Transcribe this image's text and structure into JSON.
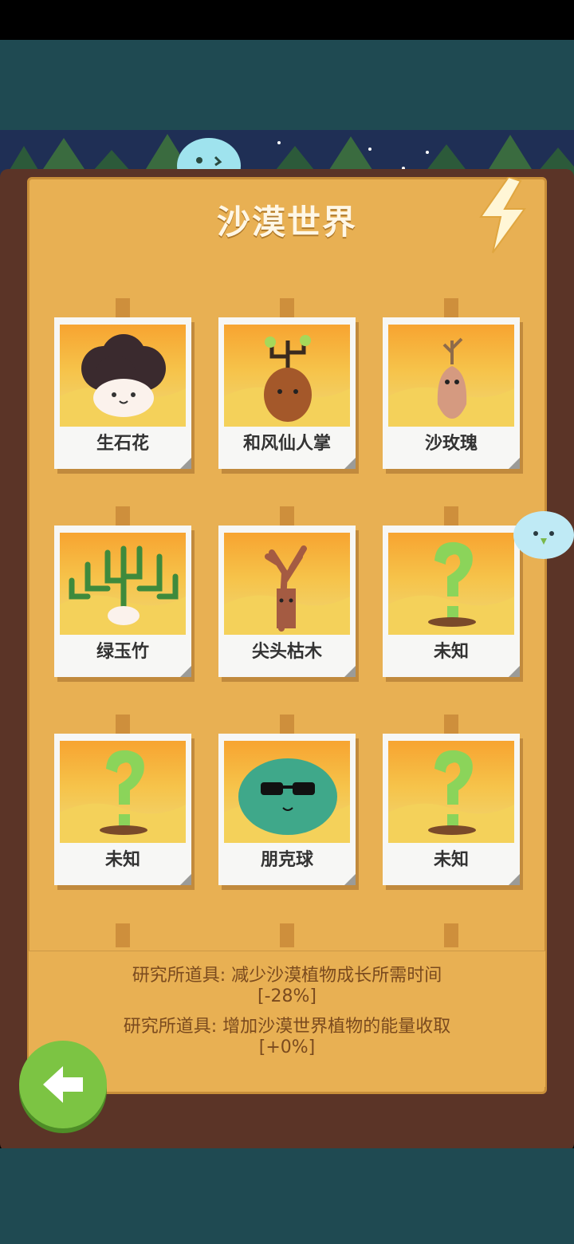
{
  "header": {
    "title": "沙漠世界"
  },
  "plants": [
    {
      "name": "生石花",
      "art": "lithops-icon"
    },
    {
      "name": "和风仙人掌",
      "art": "cactus-icon"
    },
    {
      "name": "沙玫瑰",
      "art": "desert-rose-icon"
    },
    {
      "name": "绿玉竹",
      "art": "pencil-cactus-icon"
    },
    {
      "name": "尖头枯木",
      "art": "dead-tree-icon"
    },
    {
      "name": "未知",
      "art": "question-mark-icon"
    },
    {
      "name": "未知",
      "art": "question-mark-icon"
    },
    {
      "name": "朋克球",
      "art": "punk-ball-icon"
    },
    {
      "name": "未知",
      "art": "question-mark-icon"
    }
  ],
  "research": {
    "line1": "研究所道具: 减少沙漠植物成长所需时间",
    "value1": "[-28%]",
    "line2": "研究所道具: 增加沙漠世界植物的能量收取",
    "value2": "[+0%]"
  },
  "colors": {
    "panel": "#e8b053",
    "wood": "#5b3427",
    "accent_green": "#7cc443",
    "text_brown": "#7a4a1e"
  }
}
